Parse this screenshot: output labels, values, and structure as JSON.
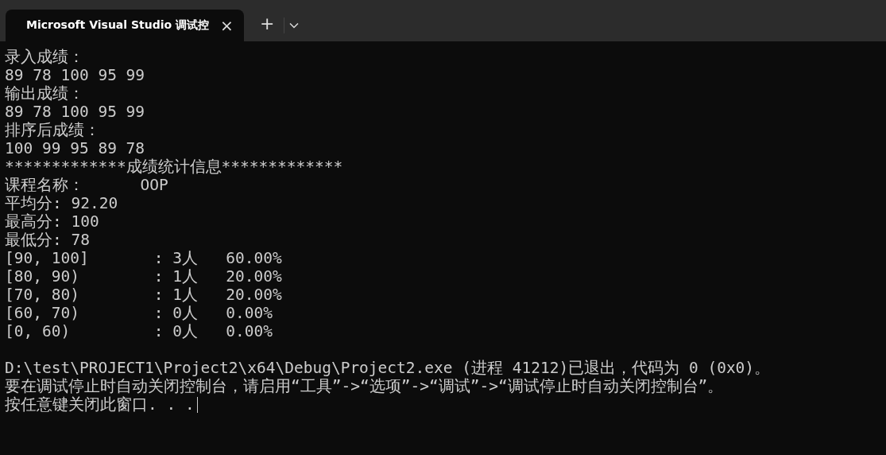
{
  "tabs": [
    {
      "title": "Microsoft Visual Studio 调试控",
      "selected": true,
      "close": "×"
    }
  ],
  "toolbar": {
    "new_tab": "+"
  },
  "console": {
    "output_lines": [
      "录入成绩：",
      "89 78 100 95 99",
      "输出成绩：",
      "89 78 100 95 99",
      "排序后成绩：",
      "100 99 95 89 78",
      "*************成绩统计信息*************",
      "课程名称：      OOP",
      "平均分: 92.20",
      "最高分: 100",
      "最低分: 78",
      "[90, 100]       : 3人   60.00%",
      "[80, 90)        : 1人   20.00%",
      "[70, 80)        : 1人   20.00%",
      "[60, 70)        : 0人   0.00%",
      "[0, 60)         : 0人   0.00%"
    ],
    "exit_lines": [
      "D:\\test\\PROJECT1\\Project2\\x64\\Debug\\Project2.exe (进程 41212)已退出，代码为 0 (0x0)。",
      "要在调试停止时自动关闭控制台，请启用“工具”->“选项”->“调试”->“调试停止时自动关闭控制台”。",
      "按任意键关闭此窗口. . ."
    ]
  }
}
